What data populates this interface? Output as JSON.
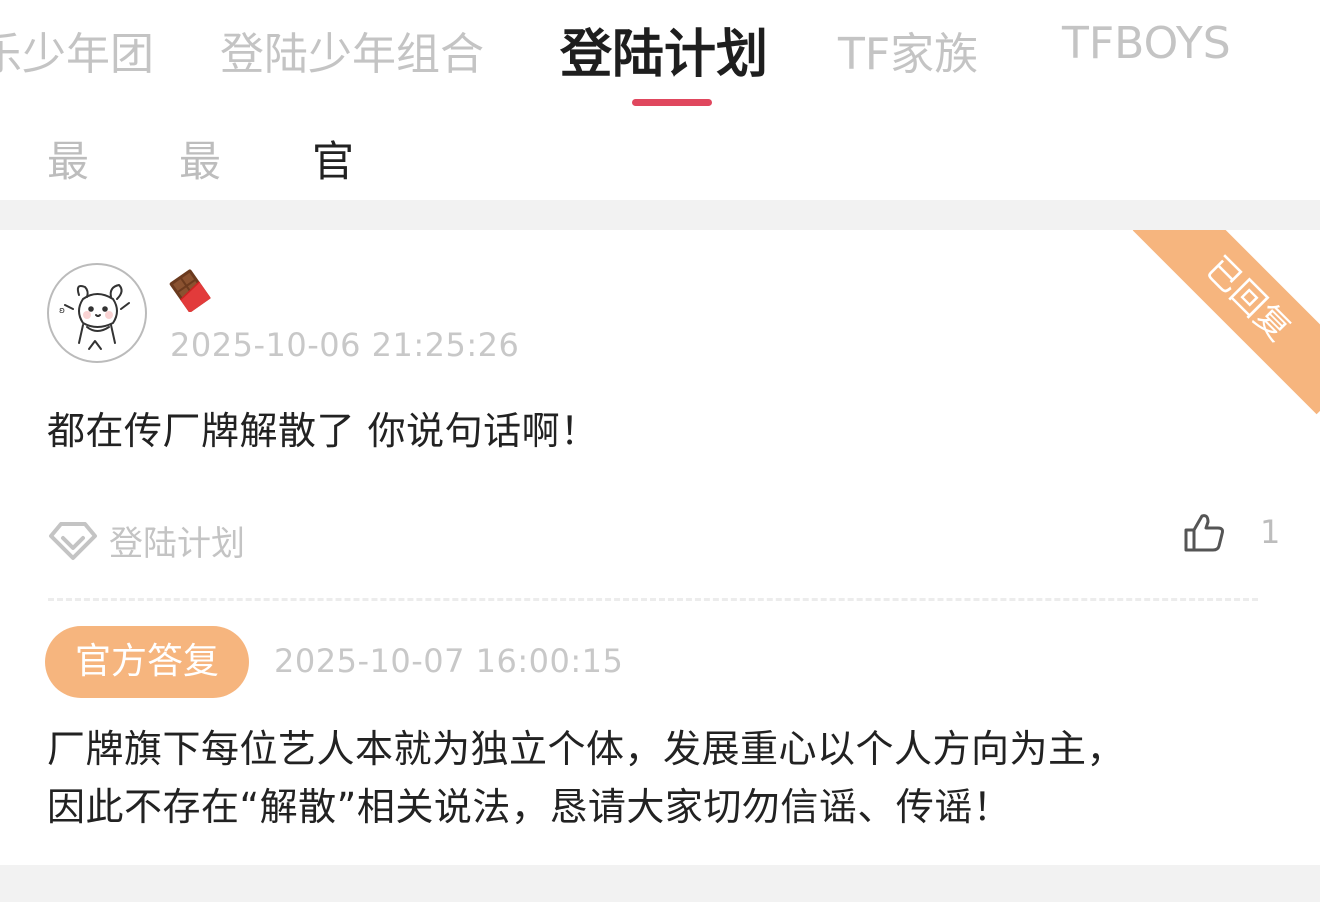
{
  "top_tabs": [
    {
      "label": "乐少年团"
    },
    {
      "label": "登陆少年组合"
    },
    {
      "label": "登陆计划",
      "active": true
    },
    {
      "label": "TF家族"
    },
    {
      "label": "TFBOYS"
    }
  ],
  "sub_tabs": [
    {
      "label": "最热"
    },
    {
      "label": "最新"
    },
    {
      "label": "官方回复",
      "active": true
    }
  ],
  "post": {
    "corner_badge": "已回复",
    "author_name": "🍫",
    "timestamp": "2025-10-06 21:25:26",
    "text": "都在传厂牌解散了 你说句话啊！",
    "topic": "登陆计划",
    "like_count": "1",
    "reply": {
      "badge": "官方答复",
      "timestamp": "2025-10-07 16:00:15",
      "line1": "厂牌旗下每位艺人本就为独立个体，发展重心以个人方向为主，",
      "line2": "因此不存在“解散”相关说法，恳请大家切勿信谣、传谣！"
    }
  },
  "colors": {
    "accent_red": "#e0475e",
    "official_orange": "#f6b57e",
    "muted_text": "#c4c4c4"
  },
  "icons": [
    "chocolate-icon",
    "topic-diamond-icon",
    "thumbs-up-icon",
    "avatar-hamster-icon"
  ]
}
